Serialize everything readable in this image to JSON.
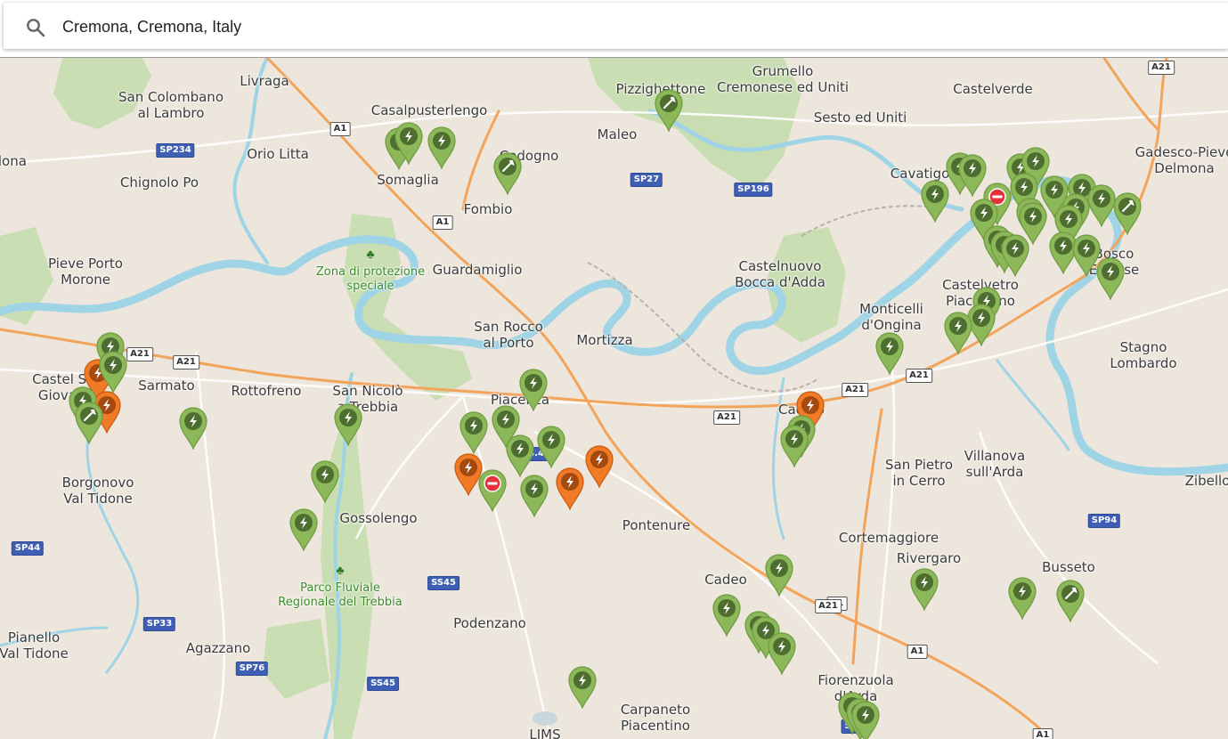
{
  "search": {
    "value": "Cremona, Cremona, Italy",
    "icon": "search-icon"
  },
  "colors": {
    "station_green": "#8cb85a",
    "station_orange": "#f07a25",
    "station_blocked_icon": "#e5323a",
    "water": "#9fd4e6",
    "park": "#c8ddb0",
    "highway": "#f3a45b"
  },
  "places": [
    {
      "name": "Livraga"
    },
    {
      "name": "San Colombano\nal Lambro"
    },
    {
      "name": "Orio Litta"
    },
    {
      "name": "Chignolo Po"
    },
    {
      "name": "Pieve Porto\nMorone"
    },
    {
      "name": "Casalpusterlengo"
    },
    {
      "name": "Codogno"
    },
    {
      "name": "Somaglia"
    },
    {
      "name": "Fombio"
    },
    {
      "name": "Guardamiglio"
    },
    {
      "name": "Pizzighettone"
    },
    {
      "name": "Maleo"
    },
    {
      "name": "Grumello\nCremonese ed Uniti"
    },
    {
      "name": "Castelverde"
    },
    {
      "name": "Sesto ed Uniti"
    },
    {
      "name": "Cavatigozzi"
    },
    {
      "name": "Gadesco-Pieve\nDelmona"
    },
    {
      "name": "Bosco\nEmerse"
    },
    {
      "name": "Castelnuovo\nBocca d'Adda"
    },
    {
      "name": "Castelvetro\nPiacentino"
    },
    {
      "name": "Monticelli\nd'Ongina"
    },
    {
      "name": "Stagno\nLombardo"
    },
    {
      "name": "San Rocco\nal Porto"
    },
    {
      "name": "Mortizza"
    },
    {
      "name": "Castel San\nGiovanni"
    },
    {
      "name": "Sarmato"
    },
    {
      "name": "Rottofreno"
    },
    {
      "name": "San Nicolò\na Trebbia"
    },
    {
      "name": "Piacenza"
    },
    {
      "name": "Caorso"
    },
    {
      "name": "Villanova\nsull'Arda"
    },
    {
      "name": "San Pietro\nin Cerro"
    },
    {
      "name": "Borgonovo\nVal Tidone"
    },
    {
      "name": "Gossolengo"
    },
    {
      "name": "Pontenure"
    },
    {
      "name": "Cortemaggiore"
    },
    {
      "name": "Busseto"
    },
    {
      "name": "Zibello"
    },
    {
      "name": "Cadeo"
    },
    {
      "name": "Podenzano"
    },
    {
      "name": "Agazzano"
    },
    {
      "name": "Pianello\nVal Tidone"
    },
    {
      "name": "Rivergaro"
    },
    {
      "name": "Carpaneto\nPiacentino"
    },
    {
      "name": "Fiorenzuola\nd'Arda"
    },
    {
      "name": "LIMS"
    },
    {
      "name": "Olona"
    }
  ],
  "parks": [
    {
      "name": "Zona di protezione\nspeciale"
    },
    {
      "name": "Parco Fluviale\nRegionale del Trebbia"
    }
  ],
  "roads": [
    "A1",
    "A1",
    "A1",
    "A1",
    "A1",
    "A21",
    "A21",
    "A21",
    "A21",
    "A21",
    "A21",
    "A21",
    "SP234",
    "SP27",
    "SP196",
    "SP44",
    "SP33",
    "SP76",
    "SS45",
    "SS45",
    "SP94",
    "SS9",
    "S.S.45"
  ],
  "stations": [
    {
      "type": "charger",
      "status": "available"
    },
    {
      "type": "charger",
      "status": "available"
    },
    {
      "type": "charger",
      "status": "available"
    },
    {
      "type": "service",
      "status": "available"
    },
    {
      "type": "service",
      "status": "available"
    },
    {
      "type": "charger",
      "status": "available"
    },
    {
      "type": "charger",
      "status": "available"
    },
    {
      "type": "charger",
      "status": "blocked"
    },
    {
      "type": "charger",
      "status": "available"
    },
    {
      "type": "charger",
      "status": "available"
    },
    {
      "type": "charger",
      "status": "available"
    },
    {
      "type": "charger",
      "status": "available"
    },
    {
      "type": "charger",
      "status": "available"
    },
    {
      "type": "charger",
      "status": "available"
    },
    {
      "type": "charger",
      "status": "available"
    },
    {
      "type": "charger",
      "status": "available"
    },
    {
      "type": "charger",
      "status": "available"
    },
    {
      "type": "charger",
      "status": "available"
    },
    {
      "type": "service",
      "status": "available"
    },
    {
      "type": "charger",
      "status": "available"
    },
    {
      "type": "charger",
      "status": "available"
    },
    {
      "type": "charger",
      "status": "available"
    },
    {
      "type": "charger",
      "status": "available"
    },
    {
      "type": "charger",
      "status": "available"
    },
    {
      "type": "charger",
      "status": "available"
    },
    {
      "type": "charger",
      "status": "available"
    },
    {
      "type": "charger",
      "status": "available"
    },
    {
      "type": "charger",
      "status": "available"
    },
    {
      "type": "charger",
      "status": "available"
    },
    {
      "type": "charger",
      "status": "available"
    },
    {
      "type": "charger",
      "status": "available"
    },
    {
      "type": "charger",
      "status": "busy"
    },
    {
      "type": "charger",
      "status": "busy"
    },
    {
      "type": "charger",
      "status": "available"
    },
    {
      "type": "charger",
      "status": "available"
    },
    {
      "type": "charger",
      "status": "available"
    },
    {
      "type": "service",
      "status": "available"
    },
    {
      "type": "charger",
      "status": "available"
    },
    {
      "type": "charger",
      "status": "available"
    },
    {
      "type": "charger",
      "status": "available"
    },
    {
      "type": "charger",
      "status": "available"
    },
    {
      "type": "charger",
      "status": "busy"
    },
    {
      "type": "charger",
      "status": "available"
    },
    {
      "type": "charger",
      "status": "available"
    },
    {
      "type": "charger",
      "status": "blocked"
    },
    {
      "type": "charger",
      "status": "busy"
    },
    {
      "type": "charger",
      "status": "available"
    },
    {
      "type": "charger",
      "status": "busy"
    },
    {
      "type": "charger",
      "status": "available"
    },
    {
      "type": "charger",
      "status": "available"
    },
    {
      "type": "charger",
      "status": "available"
    },
    {
      "type": "charger",
      "status": "busy"
    },
    {
      "type": "charger",
      "status": "available"
    },
    {
      "type": "charger",
      "status": "available"
    },
    {
      "type": "charger",
      "status": "available"
    },
    {
      "type": "charger",
      "status": "available"
    },
    {
      "type": "charger",
      "status": "available"
    },
    {
      "type": "charger",
      "status": "available"
    },
    {
      "type": "charger",
      "status": "available"
    },
    {
      "type": "charger",
      "status": "available"
    },
    {
      "type": "charger",
      "status": "available"
    },
    {
      "type": "charger",
      "status": "available"
    },
    {
      "type": "charger",
      "status": "available"
    },
    {
      "type": "service",
      "status": "available"
    },
    {
      "type": "charger",
      "status": "available"
    },
    {
      "type": "charger",
      "status": "available"
    }
  ]
}
